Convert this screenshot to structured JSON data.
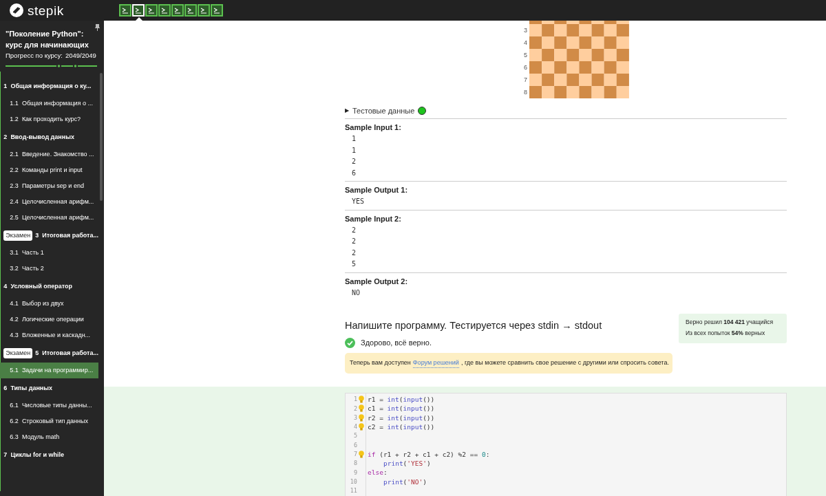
{
  "brand": "stepik",
  "steps": [
    {
      "selected": false,
      "passed": true
    },
    {
      "selected": true,
      "passed": true
    },
    {
      "selected": false,
      "passed": true
    },
    {
      "selected": false,
      "passed": true
    },
    {
      "selected": false,
      "passed": true
    },
    {
      "selected": false,
      "passed": true
    },
    {
      "selected": false,
      "passed": true
    },
    {
      "selected": false,
      "passed": true
    }
  ],
  "sidebar": {
    "course_title": "\"Поколение Python\": курс для начинающих",
    "progress_label": "Прогресс по курсу:",
    "progress_value": "2049/2049",
    "items": [
      {
        "kind": "section",
        "number": "1",
        "title": "Общая информация о ку...",
        "selected": false
      },
      {
        "kind": "lesson",
        "number": "1.1",
        "title": "Общая информация о ...",
        "selected": false
      },
      {
        "kind": "lesson",
        "number": "1.2",
        "title": "Как проходить курс?",
        "selected": false
      },
      {
        "kind": "section",
        "number": "2",
        "title": "Ввод-вывод данных",
        "selected": false
      },
      {
        "kind": "lesson",
        "number": "2.1",
        "title": "Введение. Знакомство ...",
        "selected": false
      },
      {
        "kind": "lesson",
        "number": "2.2",
        "title": "Команды print и input",
        "selected": false
      },
      {
        "kind": "lesson",
        "number": "2.3",
        "title": "Параметры sep и end",
        "selected": false
      },
      {
        "kind": "lesson",
        "number": "2.4",
        "title": "Целочисленная арифм...",
        "selected": false
      },
      {
        "kind": "lesson",
        "number": "2.5",
        "title": "Целочисленная арифм...",
        "selected": false
      },
      {
        "kind": "section",
        "badge": "Экзамен",
        "number": "3",
        "title": "Итоговая работа...",
        "selected": false
      },
      {
        "kind": "lesson",
        "number": "3.1",
        "title": "Часть 1",
        "selected": false
      },
      {
        "kind": "lesson",
        "number": "3.2",
        "title": "Часть 2",
        "selected": false
      },
      {
        "kind": "section",
        "number": "4",
        "title": "Условный оператор",
        "selected": false
      },
      {
        "kind": "lesson",
        "number": "4.1",
        "title": "Выбор из двух",
        "selected": false
      },
      {
        "kind": "lesson",
        "number": "4.2",
        "title": "Логические операции",
        "selected": false
      },
      {
        "kind": "lesson",
        "number": "4.3",
        "title": "Вложенные и каскадн...",
        "selected": false
      },
      {
        "kind": "section",
        "badge": "Экзамен",
        "number": "5",
        "title": "Итоговая работа...",
        "selected": false
      },
      {
        "kind": "lesson",
        "number": "5.1",
        "title": "Задачи на программир...",
        "selected": true
      },
      {
        "kind": "section",
        "number": "6",
        "title": "Типы данных",
        "selected": false
      },
      {
        "kind": "lesson",
        "number": "6.1",
        "title": "Числовые типы данны...",
        "selected": false
      },
      {
        "kind": "lesson",
        "number": "6.2",
        "title": "Строковый тип данных",
        "selected": false
      },
      {
        "kind": "lesson",
        "number": "6.3",
        "title": "Модуль math",
        "selected": false
      },
      {
        "kind": "section",
        "number": "7",
        "title": "Циклы for и while",
        "selected": false
      }
    ]
  },
  "board": {
    "row_labels": [
      "3",
      "4",
      "5",
      "6",
      "7",
      "8"
    ]
  },
  "test_data": {
    "toggle": "▶",
    "label": "Тестовые данные",
    "passed": true
  },
  "samples": [
    {
      "title": "Sample Input 1:",
      "lines": [
        "1",
        "1",
        "2",
        "6"
      ]
    },
    {
      "title": "Sample Output 1:",
      "lines": [
        "YES"
      ]
    },
    {
      "title": "Sample Input 2:",
      "lines": [
        "2",
        "2",
        "2",
        "5"
      ]
    },
    {
      "title": "Sample Output 2:",
      "lines": [
        "NO"
      ]
    }
  ],
  "task": {
    "heading": "Напишите программу. Тестируется через stdin → stdout",
    "result": "Здорово, всё верно.",
    "notice": {
      "before": "Теперь вам доступен",
      "link": "Форум решений",
      "after": ", где вы можете сравнить свое решение с другими или спросить совета."
    },
    "stats": [
      "Верно решил **104 421** учащийся",
      "Из всех попыток **54%** верных"
    ]
  },
  "code": [
    {
      "number": "1",
      "hint": true,
      "indented": false,
      "tokens": [
        {
          "kind": "plain",
          "t": "r1 = "
        },
        {
          "kind": "builtin",
          "t": "int"
        },
        {
          "kind": "plain",
          "t": "("
        },
        {
          "kind": "builtin",
          "t": "input"
        },
        {
          "kind": "plain",
          "t": "())"
        }
      ]
    },
    {
      "number": "2",
      "hint": true,
      "indented": false,
      "tokens": [
        {
          "kind": "plain",
          "t": "c1 = "
        },
        {
          "kind": "builtin",
          "t": "int"
        },
        {
          "kind": "plain",
          "t": "("
        },
        {
          "kind": "builtin",
          "t": "input"
        },
        {
          "kind": "plain",
          "t": "())"
        }
      ]
    },
    {
      "number": "3",
      "hint": true,
      "indented": false,
      "tokens": [
        {
          "kind": "plain",
          "t": "r2 = "
        },
        {
          "kind": "builtin",
          "t": "int"
        },
        {
          "kind": "plain",
          "t": "("
        },
        {
          "kind": "builtin",
          "t": "input"
        },
        {
          "kind": "plain",
          "t": "())"
        }
      ]
    },
    {
      "number": "4",
      "hint": true,
      "indented": false,
      "tokens": [
        {
          "kind": "plain",
          "t": "c2 = "
        },
        {
          "kind": "builtin",
          "t": "int"
        },
        {
          "kind": "plain",
          "t": "("
        },
        {
          "kind": "builtin",
          "t": "input"
        },
        {
          "kind": "plain",
          "t": "())"
        }
      ]
    },
    {
      "number": "5",
      "hint": false
    },
    {
      "number": "6",
      "hint": false
    },
    {
      "number": "7",
      "hint": true,
      "indented": false,
      "tokens": [
        {
          "kind": "keyword",
          "t": "if"
        },
        {
          "kind": "plain",
          "t": " (r1 + r2 + c1 + c2) %2 == "
        },
        {
          "kind": "number",
          "t": "0"
        },
        {
          "kind": "plain",
          "t": ":"
        }
      ]
    },
    {
      "number": "8",
      "hint": false,
      "indented": true,
      "tokens": [
        {
          "kind": "builtin",
          "t": "print"
        },
        {
          "kind": "plain",
          "t": "("
        },
        {
          "kind": "string",
          "t": "'YES'"
        },
        {
          "kind": "plain",
          "t": ")"
        }
      ]
    },
    {
      "number": "9",
      "hint": false,
      "indented": false,
      "tokens": [
        {
          "kind": "keyword",
          "t": "else"
        },
        {
          "kind": "plain",
          "t": ":"
        }
      ]
    },
    {
      "number": "10",
      "hint": false,
      "indented": true,
      "tokens": [
        {
          "kind": "builtin",
          "t": "print"
        },
        {
          "kind": "plain",
          "t": "("
        },
        {
          "kind": "string",
          "t": "'NO'"
        },
        {
          "kind": "plain",
          "t": ")"
        }
      ]
    },
    {
      "number": "11",
      "hint": false
    }
  ]
}
